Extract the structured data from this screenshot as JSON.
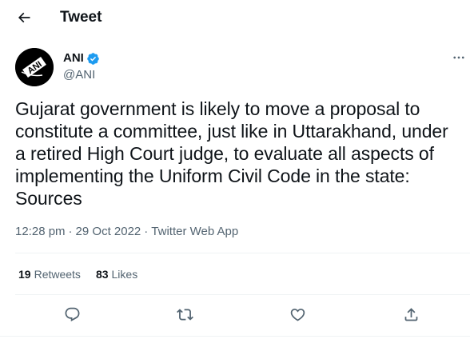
{
  "header": {
    "title": "Tweet",
    "back_icon": "arrow-left-icon"
  },
  "author": {
    "name": "ANI",
    "handle": "@ANI",
    "verified": true,
    "avatar_logo_text": "ANI",
    "verified_color": "#1d9bf0"
  },
  "tweet": {
    "text": "Gujarat government is likely to move a proposal to\nconstitute a committee, just like in Uttarakhand, under\na retired High Court judge, to evaluate all aspects of\nimplementing the Uniform Civil Code in the state:\nSources",
    "time": "12:28 pm",
    "date": "29 Oct 2022",
    "separator": "·",
    "source": "Twitter Web App"
  },
  "stats": {
    "retweets_count": "19",
    "retweets_label": "Retweets",
    "likes_count": "83",
    "likes_label": "Likes"
  },
  "actions": [
    {
      "name": "reply",
      "icon": "reply-icon"
    },
    {
      "name": "retweet",
      "icon": "retweet-icon"
    },
    {
      "name": "like",
      "icon": "heart-icon"
    },
    {
      "name": "share",
      "icon": "share-icon"
    }
  ],
  "colors": {
    "text": "#0f1419",
    "secondary": "#536471",
    "divider": "#eff3f4",
    "accent": "#1d9bf0"
  }
}
